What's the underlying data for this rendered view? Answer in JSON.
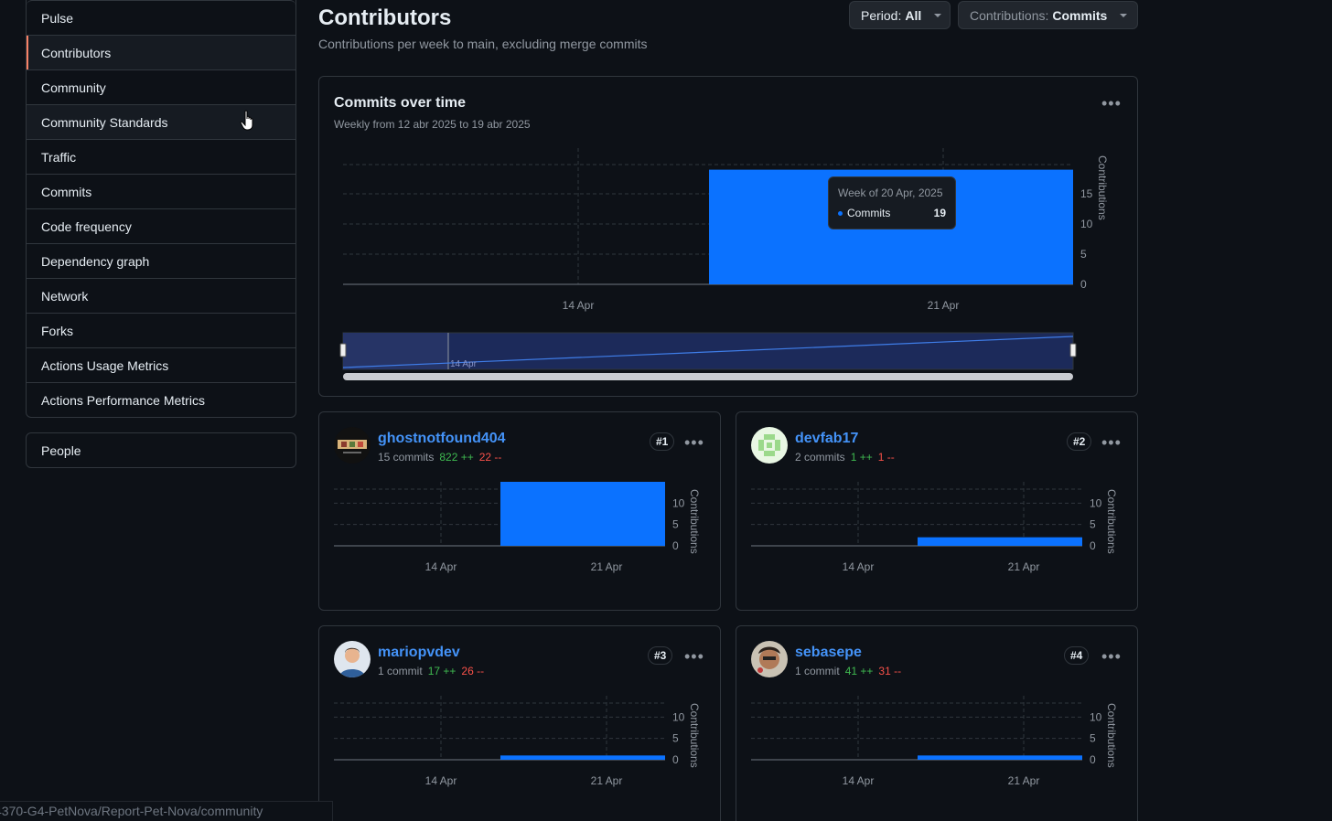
{
  "sidebar": {
    "items": [
      {
        "label": "Pulse"
      },
      {
        "label": "Contributors"
      },
      {
        "label": "Community"
      },
      {
        "label": "Community Standards"
      },
      {
        "label": "Traffic"
      },
      {
        "label": "Commits"
      },
      {
        "label": "Code frequency"
      },
      {
        "label": "Dependency graph"
      },
      {
        "label": "Network"
      },
      {
        "label": "Forks"
      },
      {
        "label": "Actions Usage Metrics"
      },
      {
        "label": "Actions Performance Metrics"
      }
    ],
    "selected": "Contributors",
    "people_label": "People"
  },
  "header": {
    "title": "Contributors",
    "subtitle": "Contributions per week to main, excluding merge commits",
    "period_label": "Period:",
    "period_value": "All",
    "contrib_label": "Contributions:",
    "contrib_value": "Commits"
  },
  "main_chart": {
    "title": "Commits over time",
    "subtitle": "Weekly from 12 abr 2025 to 19 abr 2025",
    "ylabel": "Contributions",
    "tooltip": {
      "title": "Week of 20 Apr, 2025",
      "series": "Commits",
      "value": "19"
    },
    "navigator_label": "14 Apr"
  },
  "chart_data": [
    {
      "type": "bar",
      "name": "commits-over-time",
      "categories": [
        "14 Apr",
        "21 Apr"
      ],
      "values": [
        0,
        19
      ],
      "ylabel": "Contributions",
      "yticks": [
        0,
        5,
        10,
        15
      ],
      "ylim": [
        0,
        20
      ],
      "color": "#0b72ff"
    },
    {
      "type": "bar",
      "name": "ghostnotfound404",
      "categories": [
        "14 Apr",
        "21 Apr"
      ],
      "values": [
        0,
        15
      ],
      "ylabel": "Contributions",
      "yticks": [
        0,
        5,
        10
      ],
      "ylim": [
        0,
        15
      ],
      "color": "#0b72ff"
    },
    {
      "type": "bar",
      "name": "devfab17",
      "categories": [
        "14 Apr",
        "21 Apr"
      ],
      "values": [
        0,
        2
      ],
      "ylabel": "Contributions",
      "yticks": [
        0,
        5,
        10
      ],
      "ylim": [
        0,
        15
      ],
      "color": "#0b72ff"
    },
    {
      "type": "bar",
      "name": "mariopvdev",
      "categories": [
        "14 Apr",
        "21 Apr"
      ],
      "values": [
        0,
        1
      ],
      "ylabel": "Contributions",
      "yticks": [
        0,
        5,
        10
      ],
      "ylim": [
        0,
        15
      ],
      "color": "#0b72ff"
    },
    {
      "type": "bar",
      "name": "sebasepe",
      "categories": [
        "14 Apr",
        "21 Apr"
      ],
      "values": [
        0,
        1
      ],
      "ylabel": "Contributions",
      "yticks": [
        0,
        5,
        10
      ],
      "ylim": [
        0,
        15
      ],
      "color": "#0b72ff"
    }
  ],
  "contributors": [
    {
      "username": "ghostnotfound404",
      "commits": "15 commits",
      "additions": "822 ++",
      "deletions": "22 --",
      "rank": "#1"
    },
    {
      "username": "devfab17",
      "commits": "2 commits",
      "additions": "1 ++",
      "deletions": "1 --",
      "rank": "#2"
    },
    {
      "username": "mariopvdev",
      "commits": "1 commit",
      "additions": "17 ++",
      "deletions": "26 --",
      "rank": "#3"
    },
    {
      "username": "sebasepe",
      "commits": "1 commit",
      "additions": "41 ++",
      "deletions": "31 --",
      "rank": "#4"
    }
  ],
  "status_url": "4370-G4-PetNova/Report-Pet-Nova/community",
  "colors": {
    "accent": "#0b72ff",
    "link": "#4493f8",
    "add": "#3fb950",
    "del": "#f85149",
    "selected_bar": "#f78166"
  }
}
